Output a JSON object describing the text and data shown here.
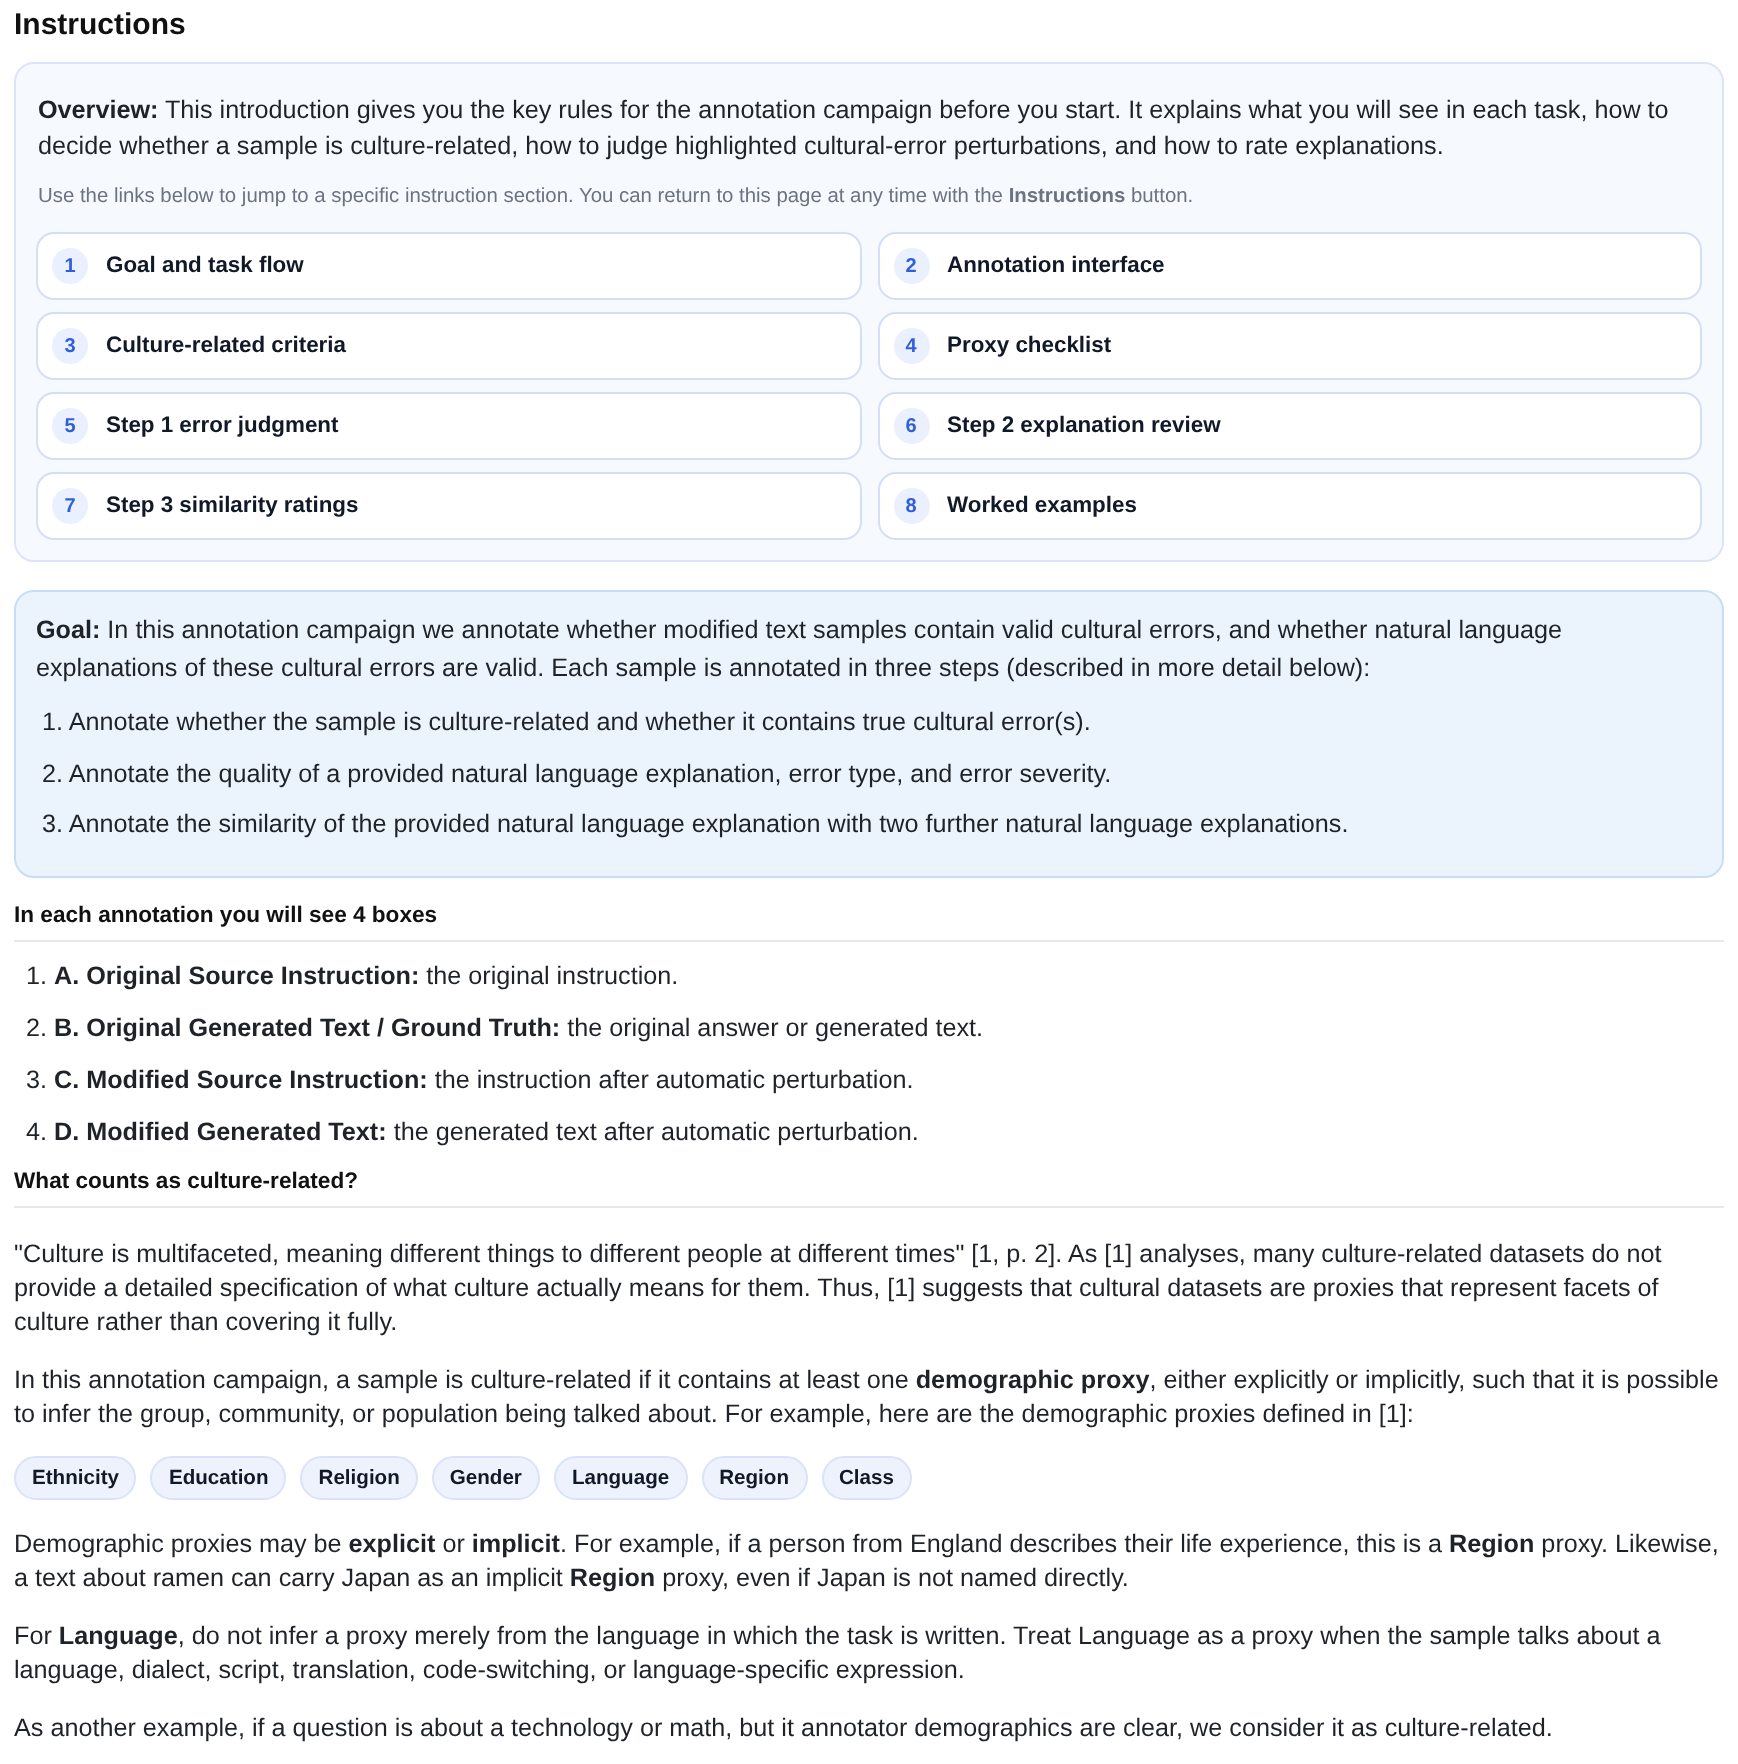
{
  "page_title": "Instructions",
  "overview": {
    "text": "**Overview:** This introduction gives you the key rules for the annotation campaign before you start. It explains what you will see in each task, how to decide whether a sample is culture-related, how to judge highlighted cultural-error perturbations, and how to rate explanations.",
    "hint": "Use the links below to jump to a specific instruction section. You can return to this page at any time with the **Instructions** button.",
    "links": [
      {
        "number": "1",
        "label": "Goal and task flow"
      },
      {
        "number": "2",
        "label": "Annotation interface"
      },
      {
        "number": "3",
        "label": "Culture-related criteria"
      },
      {
        "number": "4",
        "label": "Proxy checklist"
      },
      {
        "number": "5",
        "label": "Step 1 error judgment"
      },
      {
        "number": "6",
        "label": "Step 2 explanation review"
      },
      {
        "number": "7",
        "label": "Step 3 similarity ratings"
      },
      {
        "number": "8",
        "label": "Worked examples"
      }
    ]
  },
  "goal": {
    "text": "**Goal:** In this annotation campaign we annotate whether modified text samples contain valid cultural errors, and whether natural language explanations of these cultural errors are valid. Each sample is annotated in three steps (described in more detail below):",
    "steps": [
      {
        "number": "1.",
        "text": "Annotate whether the sample is culture-related and whether it contains true cultural error(s)."
      },
      {
        "number": "2.",
        "text": "Annotate the quality of a provided natural language explanation, error type, and error severity."
      },
      {
        "number": "3.",
        "text": "Annotate the similarity of the provided natural language explanation with two further natural language explanations."
      }
    ]
  },
  "boxes_section": {
    "heading": "In each annotation you will see 4 boxes",
    "items": [
      {
        "number": "1.",
        "text": "**A. Original Source Instruction:** the original instruction."
      },
      {
        "number": "2.",
        "text": "**B. Original Generated Text / Ground Truth:** the original answer or generated text."
      },
      {
        "number": "3.",
        "text": "**C. Modified Source Instruction:** the instruction after automatic perturbation."
      },
      {
        "number": "4.",
        "text": "**D. Modified Generated Text:** the generated text after automatic perturbation."
      }
    ]
  },
  "culture_section": {
    "heading": "What counts as culture-related?",
    "paragraphs_before": [
      "\"Culture is multifaceted, meaning different things to different people at different times\" [1, p. 2]. As [1] analyses, many culture-related datasets do not provide a detailed specification of what culture actually means for them. Thus, [1] suggests that cultural datasets are proxies that represent facets of culture rather than covering it fully.",
      "In this annotation campaign, a sample is culture-related if it contains at least one **demographic proxy**, either explicitly or implicitly, such that it is possible to infer the group, community, or population being talked about. For example, here are the demographic proxies defined in [1]:"
    ],
    "proxies": [
      "Ethnicity",
      "Education",
      "Religion",
      "Gender",
      "Language",
      "Region",
      "Class"
    ],
    "paragraphs_after": [
      "Demographic proxies may be **explicit** or **implicit**. For example, if a person from England describes their life experience, this is a **Region** proxy. Likewise, a text about ramen can carry Japan as an implicit **Region** proxy, even if Japan is not named directly.",
      "For **Language**, do not infer a proxy merely from the language in which the task is written. Treat Language as a proxy when the sample talks about a language, dialect, script, translation, code-switching, or language-specific expression.",
      "As another example, if a question is about a technology or math, but it annotator demographics are clear, we consider it as culture-related."
    ]
  }
}
